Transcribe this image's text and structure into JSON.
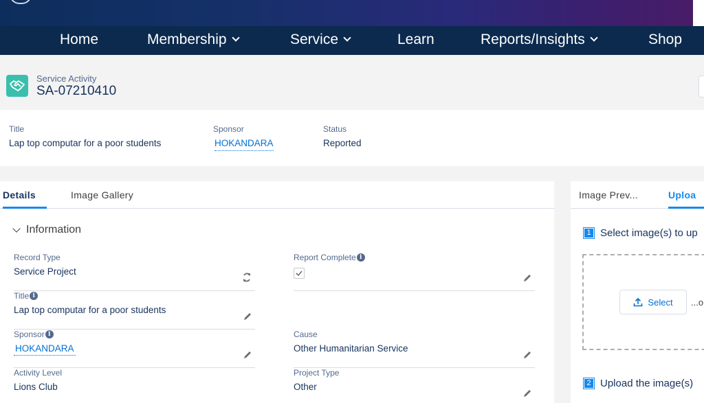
{
  "nav": {
    "items": [
      {
        "label": "Home",
        "dropdown": false
      },
      {
        "label": "Membership",
        "dropdown": true
      },
      {
        "label": "Service",
        "dropdown": true
      },
      {
        "label": "Learn",
        "dropdown": false
      },
      {
        "label": "Reports/Insights",
        "dropdown": true
      },
      {
        "label": "Shop",
        "dropdown": false
      }
    ]
  },
  "record": {
    "object_type": "Service Activity",
    "name": "SA-07210410",
    "icon": "handshake-icon",
    "icon_color": "#3bbfad"
  },
  "highlights": {
    "title_label": "Title",
    "title_value": "Lap top computar for a poor students",
    "sponsor_label": "Sponsor",
    "sponsor_value": "HOKANDARA",
    "status_label": "Status",
    "status_value": "Reported"
  },
  "main_tabs": [
    {
      "label": "Details",
      "active": true
    },
    {
      "label": "Image Gallery",
      "active": false
    }
  ],
  "section": {
    "title": "Information",
    "expanded": true
  },
  "fields": {
    "record_type": {
      "label": "Record Type",
      "value": "Service Project"
    },
    "report_complete": {
      "label": "Report Complete",
      "checked": true
    },
    "title": {
      "label": "Title",
      "value": "Lap top computar for a poor students"
    },
    "sponsor": {
      "label": "Sponsor",
      "value": "HOKANDARA"
    },
    "cause": {
      "label": "Cause",
      "value": "Other Humanitarian Service"
    },
    "activity_level": {
      "label": "Activity Level",
      "value": "Lions Club"
    },
    "project_type": {
      "label": "Project Type",
      "value": "Other"
    }
  },
  "side": {
    "tabs": [
      {
        "label": "Image Prev...",
        "active": false
      },
      {
        "label": "Uploa",
        "active": true
      }
    ],
    "step1_num": "1",
    "step1_text": "Select image(s) to up",
    "select_label": "Select",
    "or_text": "...o",
    "step2_num": "2",
    "step2_text": "Upload the image(s)"
  },
  "colors": {
    "nav_bg": "#0b2a4e",
    "accent": "#1589ee",
    "link": "#0070d2"
  }
}
